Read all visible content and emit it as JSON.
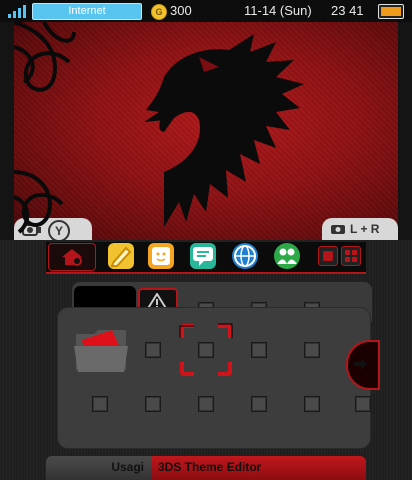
{
  "status_bar": {
    "wifi_label": "Internet",
    "coin_count": "300",
    "coin_symbol": "G",
    "date": "11-14 (Sun)",
    "time": "23 41",
    "battery_level": 1.0
  },
  "top_screen": {
    "left_tab_glyph": "Y",
    "right_tab_glyph": "L + R"
  },
  "bottom_screen": {
    "footer": {
      "author": "Usagi",
      "editor": "3DS Theme Editor"
    }
  },
  "colors": {
    "accent": "#b4151a",
    "wallpaper_red": "#8e1214",
    "wifi_blue": "#58c5f0",
    "coin_gold": "#f2c230",
    "battery_orange": "#f09a1c"
  }
}
